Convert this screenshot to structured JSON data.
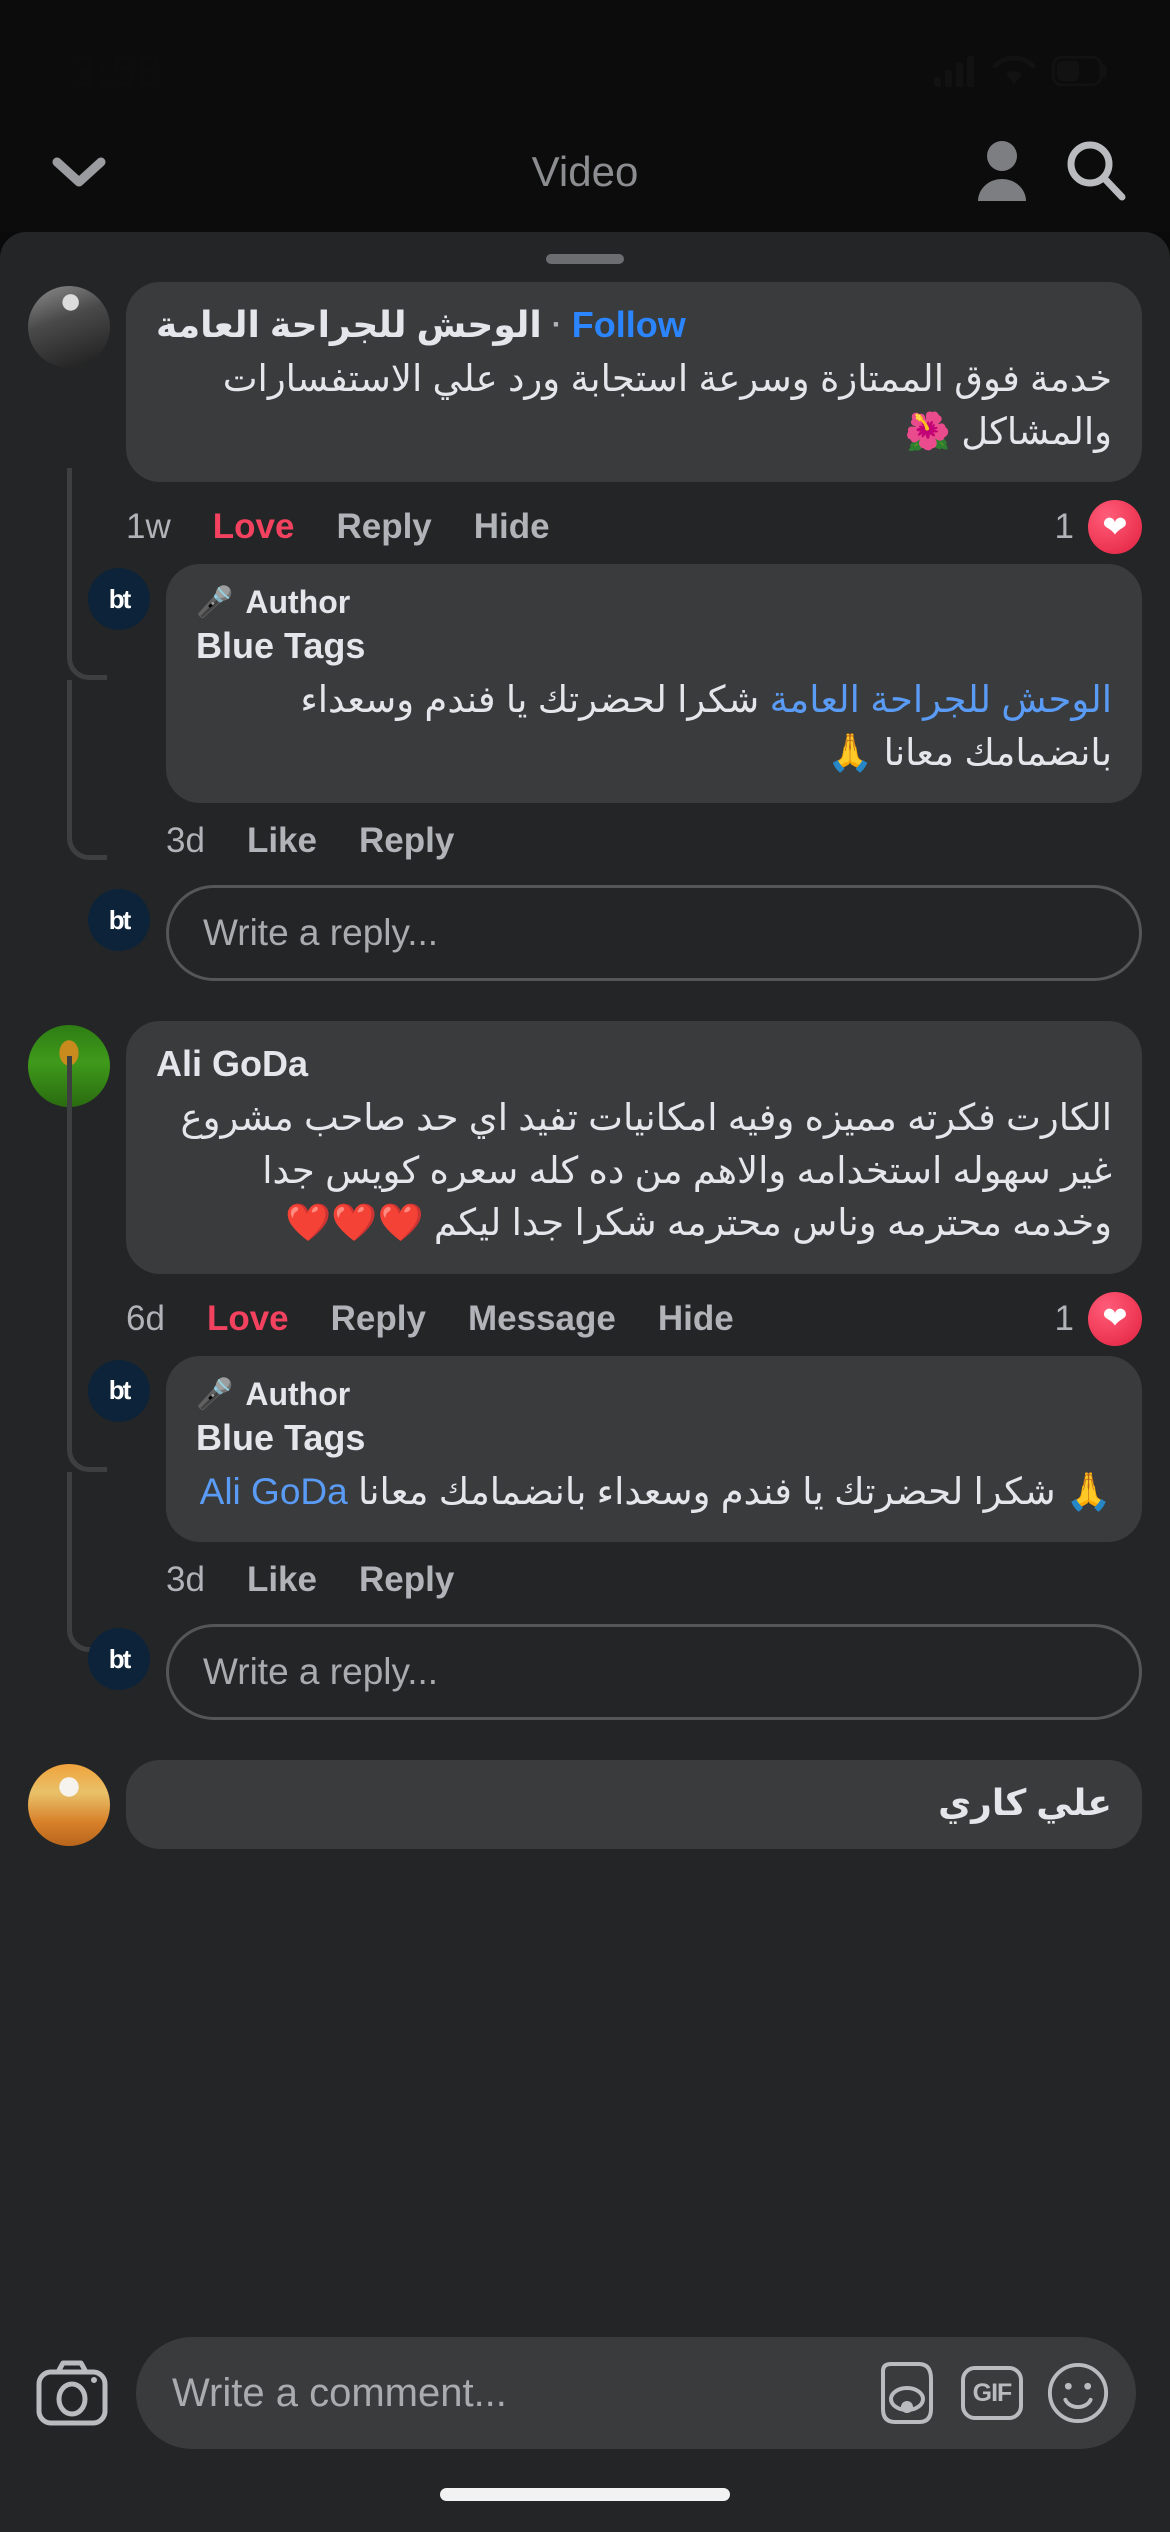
{
  "status_bar": {
    "time": "3:58",
    "cellular_icon": "cellular-signal-icon",
    "wifi_icon": "wifi-icon",
    "battery_icon": "battery-icon"
  },
  "nav": {
    "back_icon": "chevron-down-icon",
    "title": "Video",
    "profile_icon": "person-icon",
    "search_icon": "search-icon"
  },
  "comments": [
    {
      "avatar": "doctor-avatar",
      "name": "الوحش للجراحة العامة",
      "separator": "·",
      "follow_label": "Follow",
      "text": "خدمة فوق الممتازة وسرعة استجابة ورد علي الاستفسارات والمشاكل 🌺",
      "actions": {
        "time": "1w",
        "love": "Love",
        "reply": "Reply",
        "hide": "Hide"
      },
      "reaction": {
        "count": "1",
        "icon": "heart-reaction-icon"
      },
      "reply": {
        "avatar": "blue-tags-avatar",
        "avatar_initials": "bt",
        "author_badge_icon": "microphone-icon",
        "author_badge": "Author",
        "name": "Blue Tags",
        "mention": "الوحش للجراحة العامة",
        "text": "شكرا لحضرتك يا فندم وسعداء بانضمامك معانا 🙏",
        "actions": {
          "time": "3d",
          "like": "Like",
          "reply": "Reply"
        }
      },
      "reply_input": {
        "avatar_initials": "bt",
        "placeholder": "Write a reply..."
      }
    },
    {
      "avatar": "ali-goda-avatar",
      "name": "Ali GoDa",
      "text": "الكارت فكرته مميزه وفيه امكانيات تفيد اي حد صاحب مشروع غير سهوله استخدامه والاهم من ده كله سعره كويس جدا وخدمه محترمه وناس محترمه شكرا جدا ليكم ❤️❤️❤️",
      "actions": {
        "time": "6d",
        "love": "Love",
        "reply": "Reply",
        "message": "Message",
        "hide": "Hide"
      },
      "reaction": {
        "count": "1",
        "icon": "heart-reaction-icon"
      },
      "reply": {
        "avatar": "blue-tags-avatar",
        "avatar_initials": "bt",
        "author_badge_icon": "microphone-icon",
        "author_badge": "Author",
        "name": "Blue Tags",
        "mention": "Ali GoDa",
        "text": "شكرا لحضرتك يا فندم وسعداء بانضمامك معانا 🙏",
        "actions": {
          "time": "3d",
          "like": "Like",
          "reply": "Reply"
        }
      },
      "reply_input": {
        "avatar_initials": "bt",
        "placeholder": "Write a reply..."
      }
    },
    {
      "avatar": "ali-kary-avatar",
      "name": "علي كاري"
    }
  ],
  "composer": {
    "camera_icon": "camera-icon",
    "placeholder": "Write a comment...",
    "avatar_sticker_icon": "avatar-sticker-icon",
    "gif_icon": "GIF",
    "emoji_icon": "smiley-icon"
  },
  "colors": {
    "accent_blue": "#2a85ff",
    "love_red": "#f3425f",
    "bubble": "#3a3b3c",
    "sheet": "#242526",
    "text_primary": "#e4e6eb",
    "text_secondary": "#b0b3b8"
  }
}
